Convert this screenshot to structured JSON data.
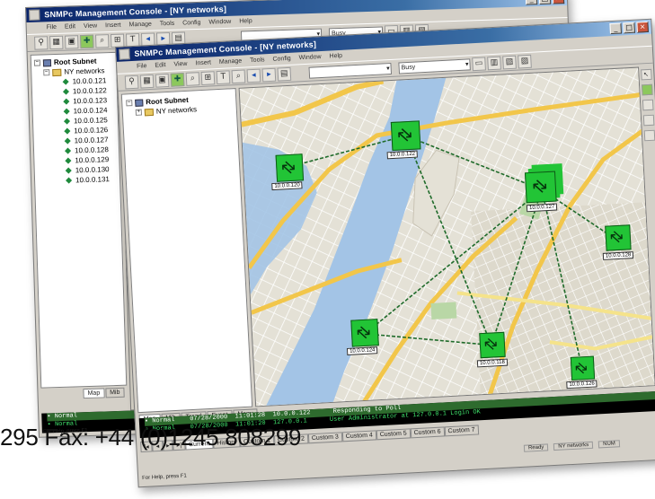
{
  "back_window": {
    "title": "SNMPc Management Console - [NY networks]",
    "menu": [
      "File",
      "Edit",
      "View",
      "Insert",
      "Manage",
      "Tools",
      "Config",
      "Window",
      "Help"
    ],
    "combo_value": "Busy",
    "tree_root": "Root Subnet",
    "tree_folder": "NY networks",
    "tree_items": [
      "10.0.0.121",
      "10.0.0.122",
      "10.0.0.123",
      "10.0.0.124",
      "10.0.0.125",
      "10.0.0.126",
      "10.0.0.127",
      "10.0.0.128",
      "10.0.0.129",
      "10.0.0.130",
      "10.0.0.131"
    ],
    "tabs": [
      "Map",
      "Mib"
    ],
    "console": [
      "Normal",
      "Normal"
    ],
    "status": "For Help, press F1"
  },
  "front_window": {
    "title": "SNMPc Management Console - [NY networks]",
    "menu": [
      "File",
      "Edit",
      "View",
      "Insert",
      "Manage",
      "Tools",
      "Config",
      "Window",
      "Help"
    ],
    "combo_value": "Busy",
    "tree_root": "Root Subnet",
    "tree_folder": "NY networks",
    "left_tabs": [
      "Map",
      "Mib",
      "Trend",
      "Event",
      "Menu"
    ],
    "nodes": [
      {
        "label": "10.0.0.122"
      },
      {
        "label": "10.0.0.120"
      },
      {
        "label": "10.0.0.127"
      },
      {
        "label": "10.0.0.128"
      },
      {
        "label": "10.0.0.124"
      },
      {
        "label": "10.0.0.118"
      },
      {
        "label": "10.0.0.126"
      }
    ],
    "console_lines": [
      {
        "status": "Normal",
        "date": "07/28/2000",
        "time": "11:01:28",
        "host": "10.0.0.122",
        "msg": "Responding to Poll"
      },
      {
        "status": "Normal",
        "date": "07/28/2000",
        "time": "11:01:20",
        "host": "127.0.0.1",
        "msg": "User Administrator at 127.0.0.1 Login OK"
      }
    ],
    "bottom_tabs": [
      "Current",
      "History",
      "Custom 1",
      "Custom 2",
      "Custom 3",
      "Custom 4",
      "Custom 5",
      "Custom 6",
      "Custom 7"
    ],
    "status_left": "For Help, press F1",
    "status_right": [
      "Ready",
      "NY networks",
      "NUM"
    ]
  },
  "fax_text": "295   Fax: +44 (0)1245 808299",
  "colors": {
    "node_green": "#22c436",
    "link_green": "#1f6b2a",
    "water": "#a3c4e6",
    "titlebar": "#0a246a",
    "console_text": "#3fe36b"
  }
}
